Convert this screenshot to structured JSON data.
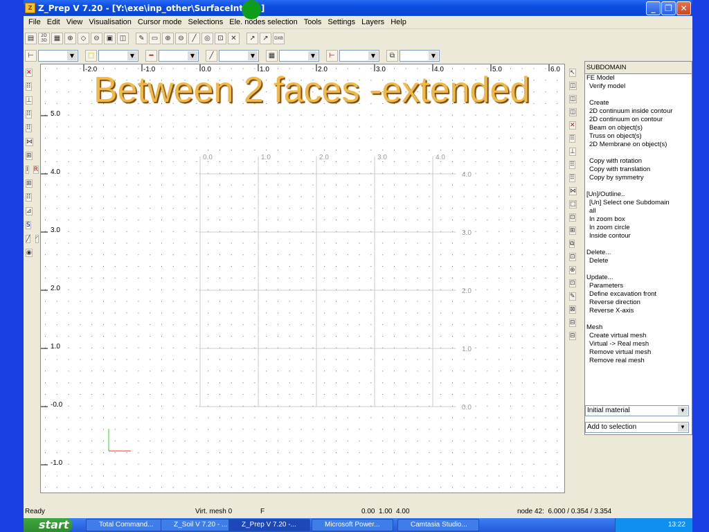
{
  "window": {
    "title": "Z_Prep V 7.20 - [Y:\\exe\\inp_other\\SurfaceInt.inp]",
    "minimize": "_",
    "maximize": "❐",
    "close": "✕"
  },
  "menu": [
    "File",
    "Edit",
    "View",
    "Visualisation",
    "Cursor mode",
    "Selections",
    "Ele. nodes selection",
    "Tools",
    "Settings",
    "Layers",
    "Help"
  ],
  "toolbar1": {
    "icons": [
      "2d-3d",
      "boxes",
      "circle-plus",
      "point",
      "point-down",
      "grid-2",
      "panel",
      "arrow",
      "zoom-window",
      "zoom-in",
      "zoom-out",
      "line",
      "circle",
      "box-t",
      "cross",
      "arrow-y1",
      "arrow-y2",
      "dxb"
    ],
    "labels": {
      "2d3d": "2D 3D",
      "dxb": "DXB"
    }
  },
  "overlay": {
    "text": "Between 2 faces -extended"
  },
  "canvas": {
    "ruler_x": [
      "-2.0",
      "-1.0",
      "0.0",
      "1.0",
      "2.0",
      "3.0",
      "4.0",
      "5.0",
      "6.0"
    ],
    "ruler_y": [
      "5.0",
      "4.0",
      "3.0",
      "2.0",
      "1.0",
      "-0.0",
      "-1.0"
    ],
    "model_x": [
      "0.0",
      "1.0",
      "2.0",
      "3.0",
      "4.0"
    ],
    "model_y": [
      "4.0",
      "3.0",
      "2.0",
      "1.0",
      "0.0"
    ]
  },
  "panel": {
    "header": "SUBDOMAIN",
    "items": [
      "FE Model",
      "Verify model",
      "",
      "Create",
      "2D continuum inside contour",
      "2D continuum on contour",
      "Beam on object(s)",
      "Truss on object(s)",
      "2D Membrane on object(s)",
      "",
      "Copy with rotation",
      "Copy with translation",
      "Copy by symmetry",
      "",
      "[Un]/Outline..",
      "[Un] Select one Subdomain",
      "all",
      "In zoom box",
      "In zoom circle",
      "Inside contour",
      "",
      "Delete...",
      "Delete",
      "",
      "Update...",
      "Parameters",
      "Define excavation front",
      "Reverse direction",
      "Reverse X-axis",
      "",
      "Mesh",
      "Create virtual mesh",
      "Virtual -> Real mesh",
      "Remove virtual mesh",
      "Remove real mesh"
    ],
    "indent": [
      false,
      true,
      false,
      true,
      true,
      true,
      true,
      true,
      true,
      false,
      true,
      true,
      true,
      false,
      false,
      true,
      true,
      true,
      true,
      true,
      false,
      false,
      true,
      false,
      false,
      true,
      true,
      true,
      true,
      false,
      false,
      true,
      true,
      true,
      true
    ],
    "select1": "Initial material",
    "select2": "Add to selection"
  },
  "status": {
    "ready": "Ready",
    "mesh": "Virt. mesh 0",
    "flag": "F",
    "coords": "0.00  1.00  4.00",
    "node": "node 42:  6.000 / 0.354 / 3.354"
  },
  "taskbar": {
    "start": "start",
    "tasks": [
      "Total Command...",
      "Z_Soil V 7.20 - ...",
      "Z_Prep V 7.20 -...",
      "Microsoft Power...",
      "Camtasia Studio..."
    ],
    "active": 2,
    "time": "13:22"
  }
}
